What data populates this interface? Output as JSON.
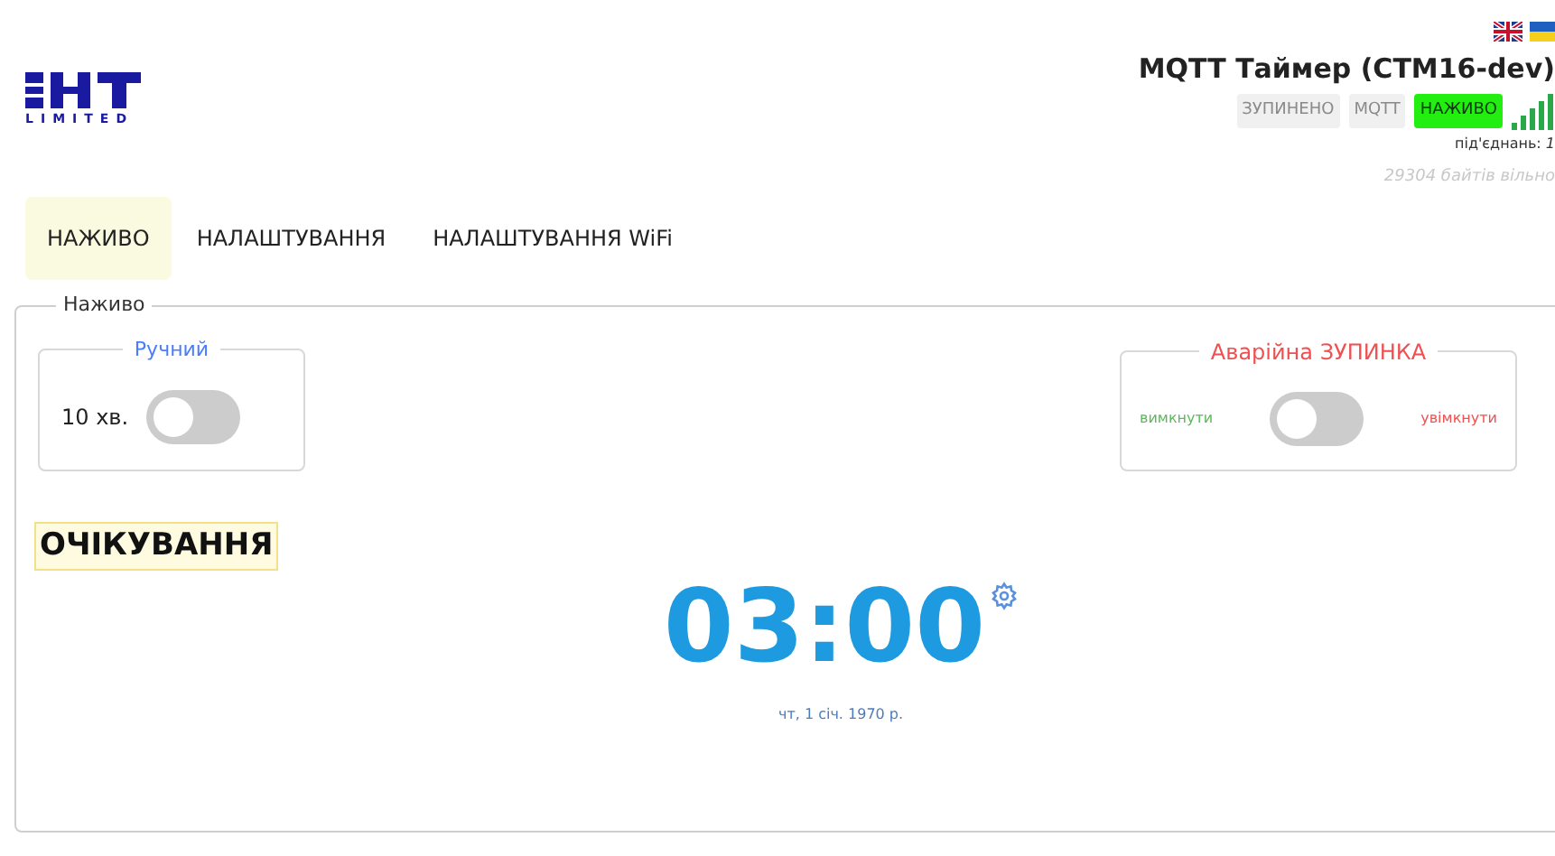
{
  "header": {
    "logo_text": "LIMITED",
    "title": "MQTT Таймер (CTM16-dev)",
    "badges": [
      {
        "label": "ЗУПИНЕНО",
        "on": false
      },
      {
        "label": "MQTT",
        "on": false
      },
      {
        "label": "НАЖИВО",
        "on": true
      }
    ],
    "connections": "під'єднань: *1*",
    "free_memory": "29304 байтів вільно"
  },
  "tabs": [
    {
      "label": "НАЖИВО",
      "selected": true
    },
    {
      "label": "НАЛАШТУВАННЯ",
      "selected": false
    },
    {
      "label": "НАЛАШТУВАННЯ WiFi",
      "selected": false
    }
  ],
  "panel": {
    "legend": "Наживо",
    "manual": {
      "legend": "Ручний",
      "label": "10 хв.",
      "on": false
    },
    "emergency": {
      "legend": "Аварійна ЗУПИНКА",
      "off_label": "вимкнути",
      "on_label": "увімкнути",
      "on": false
    },
    "status": "ОЧІКУВАННЯ",
    "timer": "03:00",
    "date": "чт, 1 січ. 1970 р."
  }
}
